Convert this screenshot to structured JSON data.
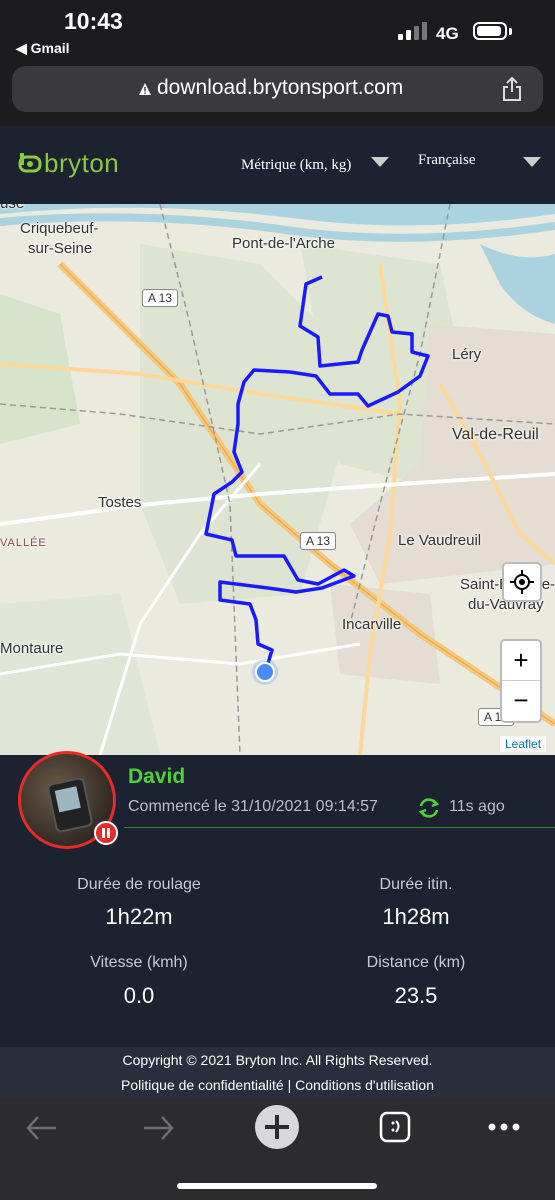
{
  "status_bar": {
    "time": "10:43",
    "back_app": "◀ Gmail",
    "network": "4G",
    "signal_bars": 2
  },
  "browser": {
    "url": "download.brytonsport.com",
    "url_lock_icon": "warning-triangle-icon"
  },
  "header": {
    "logo_text": "bryton",
    "units_label": "Métrique (km, kg)",
    "language_label": "Française",
    "brand_color": "#8dc63f"
  },
  "map": {
    "labels": [
      "Criquebeuf-",
      "sur-Seine",
      "Pont-de-l'Arche",
      "Léry",
      "Val-de-Reuil",
      "Tostes",
      "VALLÉE",
      "Le Vaudreuil",
      "Saint-Étienne-",
      "du-Vauvray",
      "Incarville",
      "Montaure",
      "use"
    ],
    "road_shields": [
      "A 13",
      "A 13",
      "A 13"
    ],
    "attribution": "Leaflet",
    "zoom_in_label": "+",
    "zoom_out_label": "−",
    "route_color": "#1a1aff"
  },
  "rider": {
    "name": "David",
    "started": "Commencé le 31/10/2021 09:14:57",
    "last_sync": "11s ago",
    "status": "paused"
  },
  "stats": {
    "riding_time_label": "Durée de roulage",
    "riding_time_value": "1h22m",
    "trip_time_label": "Durée itin.",
    "trip_time_value": "1h28m",
    "speed_label": "Vitesse (kmh)",
    "speed_value": "0.0",
    "distance_label": "Distance (km)",
    "distance_value": "23.5"
  },
  "footer": {
    "copyright": "Copyright © 2021 Bryton Inc. All Rights Reserved.",
    "privacy": "Politique de confidentialité",
    "separator": "|",
    "terms": "Conditions d'utilisation"
  }
}
